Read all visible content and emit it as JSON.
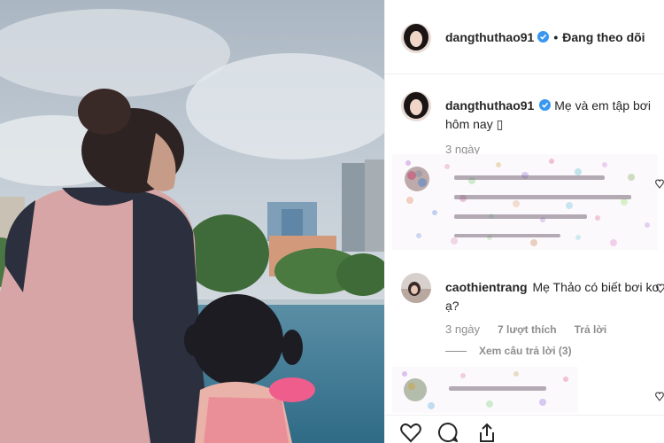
{
  "post": {
    "username": "dangthuthao91",
    "follow_separator": "•",
    "follow_status": "Đang theo dõi",
    "caption": "Mẹ và em tập bơi hôm nay",
    "caption_emoji": "▯",
    "time": "3 ngày"
  },
  "comments": [
    {
      "username": "caothientrang",
      "text": "Mẹ Thảo có biết bơi ko ạ?",
      "time": "3 ngày",
      "likes": "7 lượt thích",
      "reply_label": "Trả lời",
      "view_replies": "Xem câu trả lời (3)"
    }
  ],
  "icons": {
    "like": "heart-icon",
    "comment": "comment-icon",
    "share": "share-icon",
    "verified": "verified-badge-icon"
  },
  "colors": {
    "verified": "#3897f0",
    "muted": "#8e8e8e",
    "text": "#262626"
  }
}
